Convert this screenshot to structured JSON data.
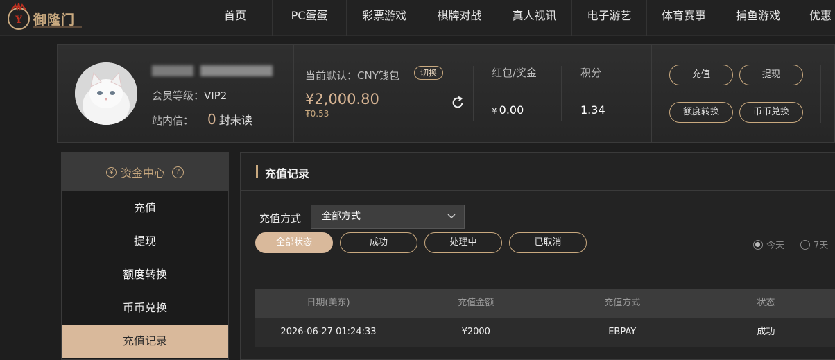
{
  "logo": {
    "text": "御隆门"
  },
  "nav": {
    "items": [
      {
        "label": "首页",
        "width": 107
      },
      {
        "label": "PC蛋蛋",
        "width": 107
      },
      {
        "label": "彩票游戏",
        "width": 109
      },
      {
        "label": "棋牌对战",
        "width": 108
      },
      {
        "label": "真人视讯",
        "width": 108
      },
      {
        "label": "电子游艺",
        "width": 108
      },
      {
        "label": "体育赛事",
        "width": 107
      },
      {
        "label": "捕鱼游戏",
        "width": 107
      },
      {
        "label": "优惠",
        "width": 80
      }
    ]
  },
  "user": {
    "vip_label": "会员等级：",
    "vip_value": "VIP2",
    "msg_label": "站内信：",
    "msg_count": "0",
    "msg_suffix": "封未读"
  },
  "wallet": {
    "label": "当前默认：CNY钱包",
    "switch_label": "切换",
    "balance": "¥2,000.80",
    "sub_balance": "₮0.53"
  },
  "stats": {
    "bonus_label": "红包/奖金",
    "bonus_symbol": "¥",
    "bonus_value": "0.00",
    "points_label": "积分",
    "points_value": "1.34"
  },
  "actions": {
    "deposit": "充值",
    "withdraw": "提现",
    "transfer": "额度转换",
    "exchange": "币币兑换"
  },
  "sidebar": {
    "title": "资金中心",
    "items": [
      {
        "label": "充值"
      },
      {
        "label": "提现"
      },
      {
        "label": "额度转换"
      },
      {
        "label": "币币兑换"
      },
      {
        "label": "充值记录"
      }
    ]
  },
  "main": {
    "title": "充值记录",
    "method_label": "充值方式",
    "method_value": "全部方式",
    "status_filters": [
      "全部状态",
      "成功",
      "处理中",
      "已取消"
    ],
    "range_options": [
      "今天",
      "7天"
    ],
    "table": {
      "headers": [
        "日期(美东)",
        "充值金额",
        "充值方式",
        "状态"
      ],
      "rows": [
        [
          "2026-06-27 01:24:33",
          "¥2000",
          "EBPAY",
          "成功"
        ]
      ]
    }
  }
}
